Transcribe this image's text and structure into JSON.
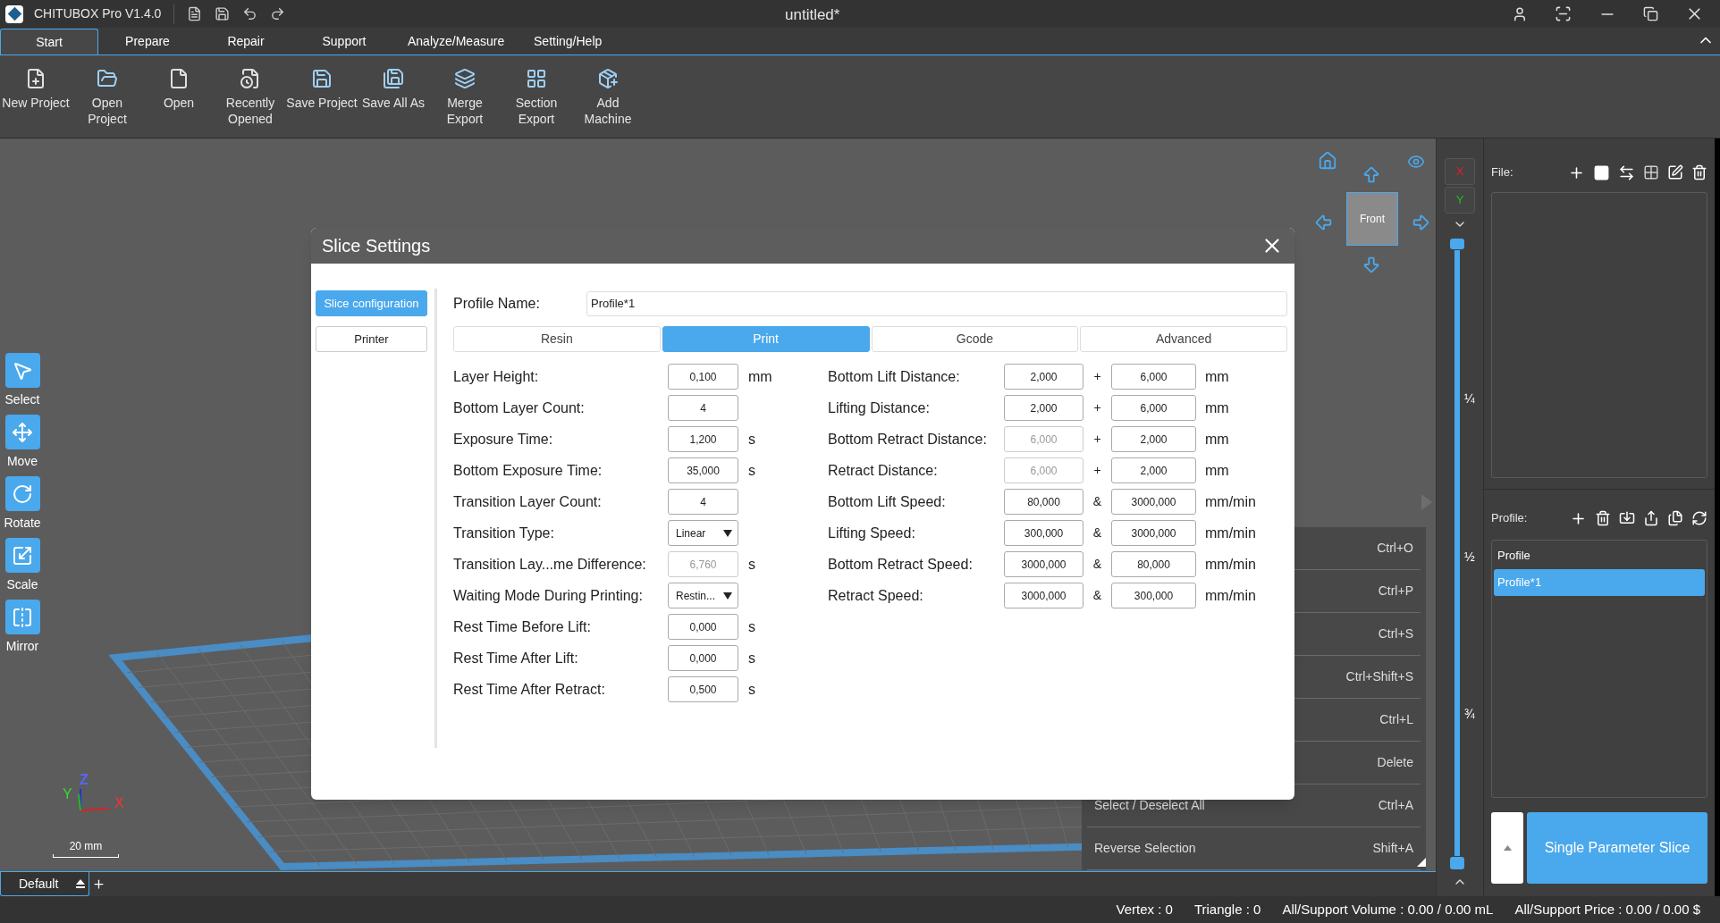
{
  "app": {
    "title": "CHITUBOX Pro V1.4.0",
    "document": "untitled*"
  },
  "menu_tabs": [
    {
      "label": "Start",
      "selected": true
    },
    {
      "label": "Prepare",
      "selected": false
    },
    {
      "label": "Repair",
      "selected": false
    },
    {
      "label": "Support",
      "selected": false
    },
    {
      "label": "Analyze/Measure",
      "selected": false
    },
    {
      "label": "Setting/Help",
      "selected": false
    }
  ],
  "ribbon": [
    "New Project",
    "Open\nProject",
    "Open",
    "Recently\nOpened",
    "Save Project",
    "Save All As",
    "Merge\nExport",
    "Section\nExport",
    "Add\nMachine"
  ],
  "tools": [
    "Select",
    "Move",
    "Rotate",
    "Scale",
    "Mirror"
  ],
  "viewport": {
    "view_cube": "Front",
    "axes": [
      "Z",
      "Y",
      "X"
    ],
    "scale": "20 mm"
  },
  "axis_buttons": [
    "X",
    "Y"
  ],
  "slider_marks": [
    "¼",
    "½",
    "¾"
  ],
  "layer_tabs": [
    {
      "label": "Default",
      "selected": true
    }
  ],
  "shortcut_menu": [
    {
      "shortcut": "Ctrl+O"
    },
    {
      "shortcut": "Ctrl+P"
    },
    {
      "shortcut": "Ctrl+S"
    },
    {
      "shortcut": "Ctrl+Shift+S"
    },
    {
      "shortcut": "Ctrl+L"
    },
    {
      "shortcut": "Delete"
    },
    {
      "label": "Select / Deselect All",
      "shortcut": "Ctrl+A"
    },
    {
      "label": "Reverse Selection",
      "shortcut": "Shift+A"
    }
  ],
  "right_panel": {
    "file_label": "File:",
    "profile_label": "Profile:",
    "profiles": [
      {
        "label": "Profile",
        "selected": false
      },
      {
        "label": "Profile*1",
        "selected": true
      }
    ],
    "slice_button": "Single Parameter Slice"
  },
  "status_bar": [
    "Vertex : 0",
    "Triangle : 0",
    "All/Support Volume : 0.00 / 0.00 mL",
    "All/Support Price : 0.00 / 0.00 $"
  ],
  "dialog": {
    "title": "Slice Settings",
    "side": [
      {
        "label": "Slice configuration",
        "selected": true
      },
      {
        "label": "Printer",
        "selected": false
      }
    ],
    "profile_name_label": "Profile Name:",
    "profile_name": "Profile*1",
    "tabs": [
      {
        "label": "Resin",
        "selected": false
      },
      {
        "label": "Print",
        "selected": true
      },
      {
        "label": "Gcode",
        "selected": false
      },
      {
        "label": "Advanced",
        "selected": false
      }
    ],
    "left_params": [
      {
        "label": "Layer Height:",
        "kind": "input",
        "value": "0,100",
        "disabled": false,
        "unit": "mm"
      },
      {
        "label": "Bottom Layer Count:",
        "kind": "input",
        "value": "4",
        "disabled": false
      },
      {
        "label": "Exposure Time:",
        "kind": "input",
        "value": "1,200",
        "disabled": false,
        "unit": "s"
      },
      {
        "label": "Bottom Exposure Time:",
        "kind": "input",
        "value": "35,000",
        "disabled": false,
        "unit": "s"
      },
      {
        "label": "Transition Layer Count:",
        "kind": "input",
        "value": "4",
        "disabled": false
      },
      {
        "label": "Transition Type:",
        "kind": "select",
        "value": "Linear",
        "disabled": false
      },
      {
        "label": "Transition Lay...me Difference:",
        "kind": "input",
        "value": "6,760",
        "disabled": true,
        "unit": "s"
      },
      {
        "label": "Waiting Mode During Printing:",
        "kind": "select",
        "value": "Restin...",
        "disabled": false
      },
      {
        "label": "Rest Time Before Lift:",
        "kind": "input",
        "value": "0,000",
        "disabled": false,
        "unit": "s"
      },
      {
        "label": "Rest Time After Lift:",
        "kind": "input",
        "value": "0,000",
        "disabled": false,
        "unit": "s"
      },
      {
        "label": "Rest Time After Retract:",
        "kind": "input",
        "value": "0,500",
        "disabled": false,
        "unit": "s"
      }
    ],
    "right_params": [
      {
        "label": "Bottom Lift Distance:",
        "values": [
          {
            "text": "2,000",
            "disabled": false
          },
          {
            "text": "6,000",
            "disabled": false
          }
        ],
        "joiner": "+",
        "unit": "mm"
      },
      {
        "label": "Lifting Distance:",
        "values": [
          {
            "text": "2,000",
            "disabled": false
          },
          {
            "text": "6,000",
            "disabled": false
          }
        ],
        "joiner": "+",
        "unit": "mm"
      },
      {
        "label": "Bottom Retract Distance:",
        "values": [
          {
            "text": "6,000",
            "disabled": true
          },
          {
            "text": "2,000",
            "disabled": false
          }
        ],
        "joiner": "+",
        "unit": "mm"
      },
      {
        "label": "Retract Distance:",
        "values": [
          {
            "text": "6,000",
            "disabled": true
          },
          {
            "text": "2,000",
            "disabled": false
          }
        ],
        "joiner": "+",
        "unit": "mm"
      },
      {
        "label": "Bottom Lift Speed:",
        "values": [
          {
            "text": "80,000",
            "disabled": false
          },
          {
            "text": "3000,000",
            "disabled": false
          }
        ],
        "joiner": "&",
        "unit": "mm/min"
      },
      {
        "label": "Lifting Speed:",
        "values": [
          {
            "text": "300,000",
            "disabled": false
          },
          {
            "text": "3000,000",
            "disabled": false
          }
        ],
        "joiner": "&",
        "unit": "mm/min"
      },
      {
        "label": "Bottom Retract Speed:",
        "values": [
          {
            "text": "3000,000",
            "disabled": false
          },
          {
            "text": "80,000",
            "disabled": false
          }
        ],
        "joiner": "&",
        "unit": "mm/min"
      },
      {
        "label": "Retract Speed:",
        "values": [
          {
            "text": "3000,000",
            "disabled": false
          },
          {
            "text": "300,000",
            "disabled": false
          }
        ],
        "joiner": "&",
        "unit": "mm/min"
      }
    ]
  }
}
